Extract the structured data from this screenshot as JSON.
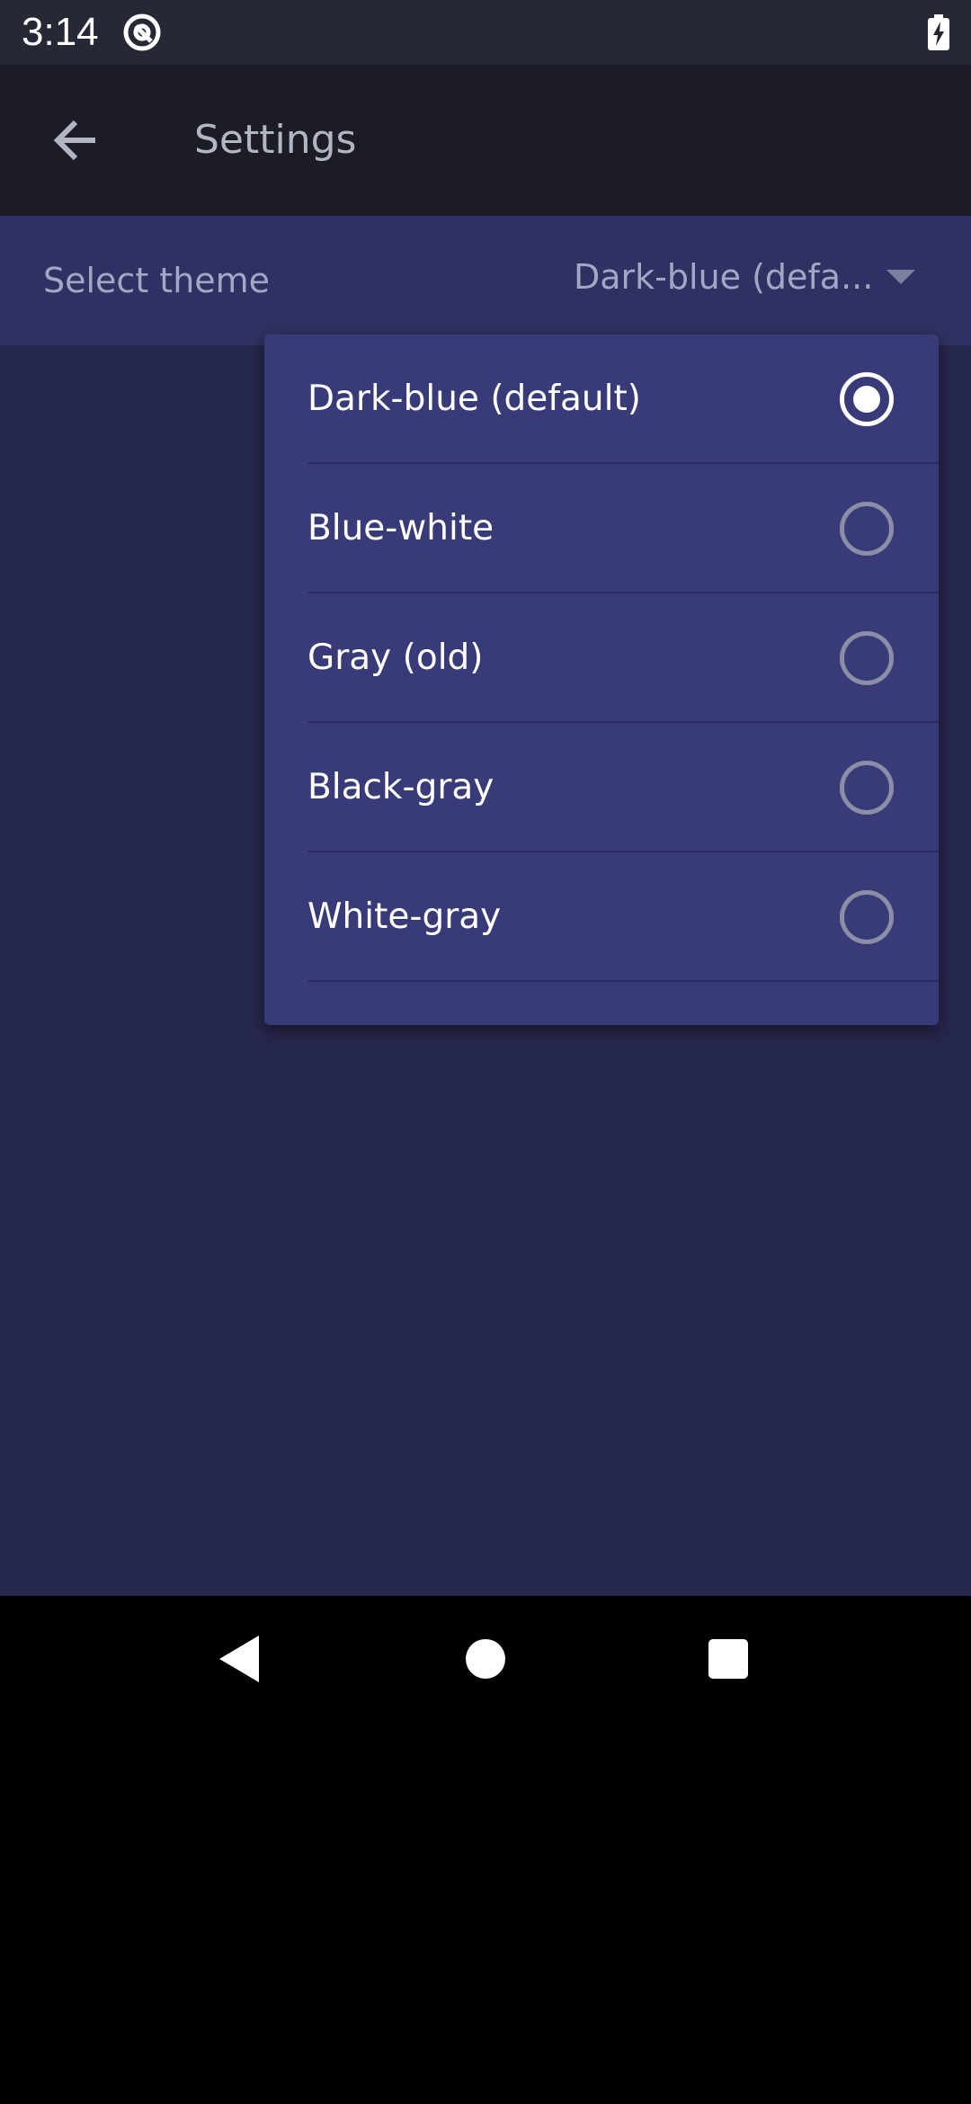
{
  "status_bar": {
    "time": "3:14",
    "app_icon": "at-sign-notification-icon",
    "battery_icon": "battery-charging-icon"
  },
  "app_bar": {
    "back_icon": "arrow-back-icon",
    "title": "Settings"
  },
  "theme_setting": {
    "label": "Select theme",
    "selected_value": "Dark-blue (defa...",
    "dropdown_icon": "dropdown-arrow-icon"
  },
  "theme_menu": {
    "options": [
      {
        "label": "Dark-blue (default)",
        "selected": true
      },
      {
        "label": "Blue-white",
        "selected": false
      },
      {
        "label": "Gray (old)",
        "selected": false
      },
      {
        "label": "Black-gray",
        "selected": false
      },
      {
        "label": "White-gray",
        "selected": false
      }
    ]
  },
  "nav_bar": {
    "back_icon": "nav-back-icon",
    "home_icon": "nav-home-icon",
    "recents_icon": "nav-recents-icon"
  },
  "colors": {
    "status_bar_bg": "#262836",
    "app_bar_bg": "#1b1c25",
    "content_bg": "#26274c",
    "setting_row_bg": "#2f3162",
    "menu_bg": "#383b77",
    "radio_selected": "#ffffff",
    "radio_unselected": "#8c8ea6"
  }
}
